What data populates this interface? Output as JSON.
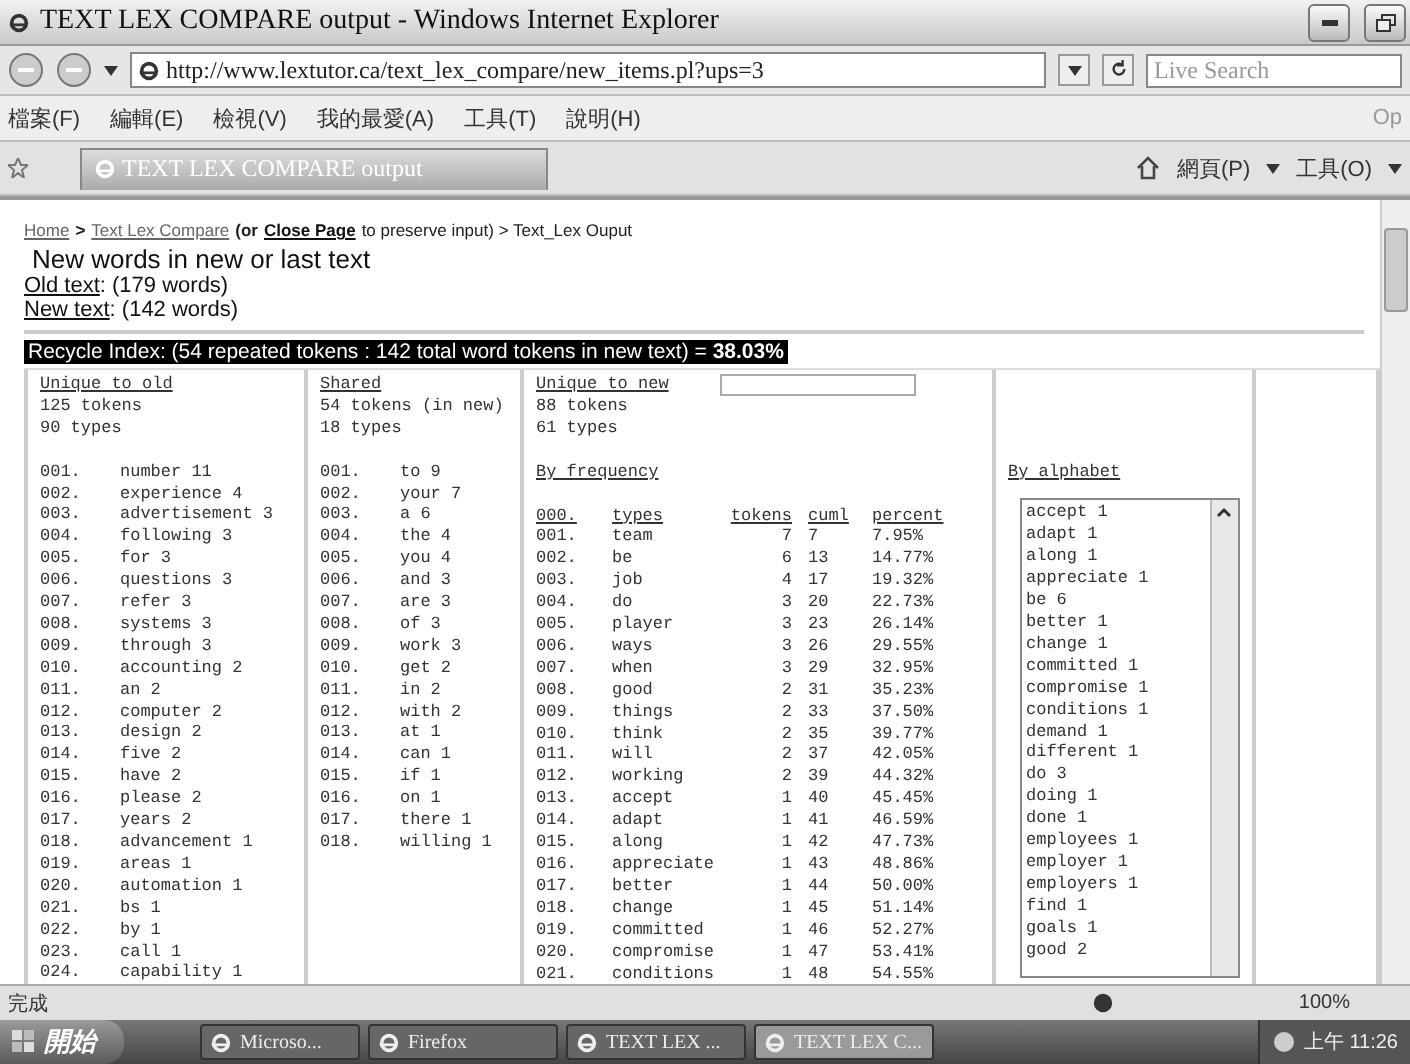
{
  "window": {
    "title": "TEXT LEX COMPARE output - Windows Internet Explorer"
  },
  "address_bar": {
    "url": "http://www.lextutor.ca/text_lex_compare/new_items.pl?ups=3",
    "search_placeholder": "Live Search"
  },
  "menu": [
    "檔案(F)",
    "編輯(E)",
    "檢視(V)",
    "我的最愛(A)",
    "工具(T)",
    "說明(H)"
  ],
  "menu_right": "Op",
  "tab": {
    "title": "TEXT LEX COMPARE output"
  },
  "command_bar": [
    {
      "kind": "icon"
    },
    {
      "kind": "text",
      "label": "網頁(P)"
    },
    {
      "kind": "text",
      "label": "工具(O)"
    }
  ],
  "page": {
    "breadcrumb": {
      "home": "Home",
      "sep1": ">",
      "text_lex_compare": "Text Lex Compare",
      "or": "(or",
      "close_page": "Close Page",
      "rest": "to preserve input) > Text_Lex Ouput"
    },
    "heading": "New words in new or last text",
    "old_text": {
      "link": "Old text",
      "count": ": (179 words)"
    },
    "new_text": {
      "link": "New text",
      "count": ": (142 words)"
    },
    "recycle_index": {
      "text": "Recycle Index: (54 repeated tokens : 142 total word tokens in new text) =",
      "value": "38.03%"
    },
    "unique_to_old": {
      "title": "Unique to old",
      "tokens": "125 tokens",
      "types": "90 types",
      "items": [
        [
          "001.",
          "number 11"
        ],
        [
          "002.",
          "experience 4"
        ],
        [
          "003.",
          "advertisement 3"
        ],
        [
          "004.",
          "following 3"
        ],
        [
          "005.",
          "for 3"
        ],
        [
          "006.",
          "questions 3"
        ],
        [
          "007.",
          "refer 3"
        ],
        [
          "008.",
          "systems 3"
        ],
        [
          "009.",
          "through 3"
        ],
        [
          "010.",
          "accounting 2"
        ],
        [
          "011.",
          "an 2"
        ],
        [
          "012.",
          "computer 2"
        ],
        [
          "013.",
          "design 2"
        ],
        [
          "014.",
          "five 2"
        ],
        [
          "015.",
          "have 2"
        ],
        [
          "016.",
          "please 2"
        ],
        [
          "017.",
          "years 2"
        ],
        [
          "018.",
          "advancement 1"
        ],
        [
          "019.",
          "areas 1"
        ],
        [
          "020.",
          "automation 1"
        ],
        [
          "021.",
          "bs 1"
        ],
        [
          "022.",
          "by 1"
        ],
        [
          "023.",
          "call 1"
        ],
        [
          "024.",
          "capability 1"
        ]
      ]
    },
    "shared": {
      "title": "Shared",
      "tokens": "54 tokens (in new)",
      "types": "18 types",
      "items": [
        [
          "001.",
          "to 9"
        ],
        [
          "002.",
          "your 7"
        ],
        [
          "003.",
          "a 6"
        ],
        [
          "004.",
          "the 4"
        ],
        [
          "005.",
          "you 4"
        ],
        [
          "006.",
          "and 3"
        ],
        [
          "007.",
          "are 3"
        ],
        [
          "008.",
          "of 3"
        ],
        [
          "009.",
          "work 3"
        ],
        [
          "010.",
          "get 2"
        ],
        [
          "011.",
          "in 2"
        ],
        [
          "012.",
          "with 2"
        ],
        [
          "013.",
          "at 1"
        ],
        [
          "014.",
          "can 1"
        ],
        [
          "015.",
          "if 1"
        ],
        [
          "016.",
          "on 1"
        ],
        [
          "017.",
          "there 1"
        ],
        [
          "018.",
          "willing 1"
        ]
      ]
    },
    "unique_to_new": {
      "title": "Unique to new",
      "tokens": "88 tokens",
      "types": "61 types",
      "by_frequency": {
        "title": "By frequency",
        "columns": [
          "000.",
          "types",
          "tokens",
          "cuml",
          "percent"
        ],
        "rows": [
          [
            "001.",
            "team",
            "7",
            "7",
            "7.95%"
          ],
          [
            "002.",
            "be",
            "6",
            "13",
            "14.77%"
          ],
          [
            "003.",
            "job",
            "4",
            "17",
            "19.32%"
          ],
          [
            "004.",
            "do",
            "3",
            "20",
            "22.73%"
          ],
          [
            "005.",
            "player",
            "3",
            "23",
            "26.14%"
          ],
          [
            "006.",
            "ways",
            "3",
            "26",
            "29.55%"
          ],
          [
            "007.",
            "when",
            "3",
            "29",
            "32.95%"
          ],
          [
            "008.",
            "good",
            "2",
            "31",
            "35.23%"
          ],
          [
            "009.",
            "things",
            "2",
            "33",
            "37.50%"
          ],
          [
            "010.",
            "think",
            "2",
            "35",
            "39.77%"
          ],
          [
            "011.",
            "will",
            "2",
            "37",
            "42.05%"
          ],
          [
            "012.",
            "working",
            "2",
            "39",
            "44.32%"
          ],
          [
            "013.",
            "accept",
            "1",
            "40",
            "45.45%"
          ],
          [
            "014.",
            "adapt",
            "1",
            "41",
            "46.59%"
          ],
          [
            "015.",
            "along",
            "1",
            "42",
            "47.73%"
          ],
          [
            "016.",
            "appreciate",
            "1",
            "43",
            "48.86%"
          ],
          [
            "017.",
            "better",
            "1",
            "44",
            "50.00%"
          ],
          [
            "018.",
            "change",
            "1",
            "45",
            "51.14%"
          ],
          [
            "019.",
            "committed",
            "1",
            "46",
            "52.27%"
          ],
          [
            "020.",
            "compromise",
            "1",
            "47",
            "53.41%"
          ],
          [
            "021.",
            "conditions",
            "1",
            "48",
            "54.55%"
          ]
        ]
      }
    },
    "by_alphabet": {
      "title": "By alphabet",
      "items": [
        "accept 1",
        "adapt 1",
        "along 1",
        "appreciate 1",
        "be 6",
        "better 1",
        "change 1",
        "committed 1",
        "compromise 1",
        "conditions 1",
        "demand 1",
        "different 1",
        "do 3",
        "doing 1",
        "done 1",
        "employees 1",
        "employer 1",
        "employers 1",
        "find 1",
        "goals 1",
        "good 2"
      ]
    }
  },
  "status_bar": {
    "text": "完成",
    "zoom": "100%"
  },
  "taskbar": {
    "start": "開始",
    "items": [
      {
        "label": "Microso...",
        "selected": false
      },
      {
        "label": "Firefox",
        "selected": false
      },
      {
        "label": "TEXT LEX ...",
        "selected": false
      },
      {
        "label": "TEXT LEX C...",
        "selected": true
      }
    ],
    "clock": "上午 11:26"
  }
}
